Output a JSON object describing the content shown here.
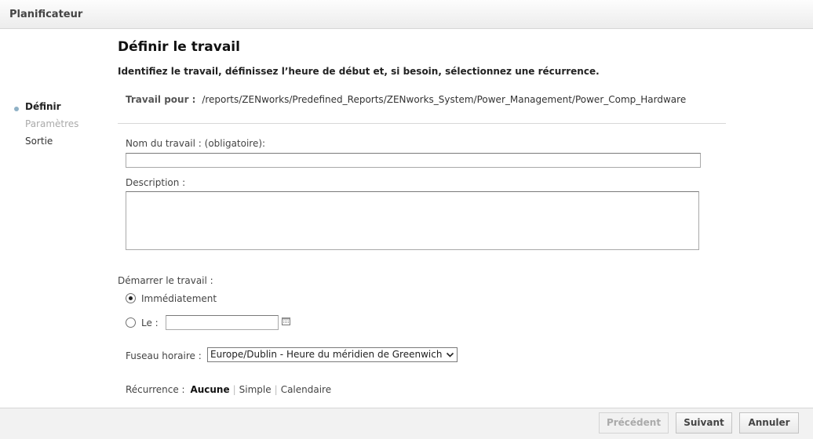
{
  "window": {
    "title": "Planificateur"
  },
  "steps": [
    {
      "label": "Définir",
      "state": "active"
    },
    {
      "label": "Paramètres",
      "state": "disabled"
    },
    {
      "label": "Sortie",
      "state": "normal"
    }
  ],
  "page": {
    "heading": "Définir le travail",
    "instructions": "Identifiez le travail, définissez l’heure de début et, si besoin, sélectionnez une récurrence.",
    "job_for_label": "Travail pour :",
    "job_for_path": "/reports/ZENworks/Predefined_Reports/ZENworks_System/Power_Management/Power_Comp_Hardware"
  },
  "form": {
    "job_name_label": "Nom du travail : (obligatoire):",
    "job_name_value": "",
    "description_label": "Description :",
    "description_value": "",
    "start_label": "Démarrer le travail :",
    "start_immediate_label": "Immédiatement",
    "start_immediate_checked": true,
    "start_on_label": "Le :",
    "start_on_value": "",
    "timezone_label": "Fuseau horaire :",
    "timezone_value": "Europe/Dublin - Heure du méridien de Greenwich",
    "recurrence_label": "Récurrence :",
    "recurrence_options": [
      "Aucune",
      "Simple",
      "Calendaire"
    ],
    "recurrence_selected": "Aucune"
  },
  "footer": {
    "previous_label": "Précédent",
    "next_label": "Suivant",
    "cancel_label": "Annuler"
  },
  "icons": {
    "calendar": "calendar-icon",
    "dropdown": "chevron-down-icon"
  }
}
